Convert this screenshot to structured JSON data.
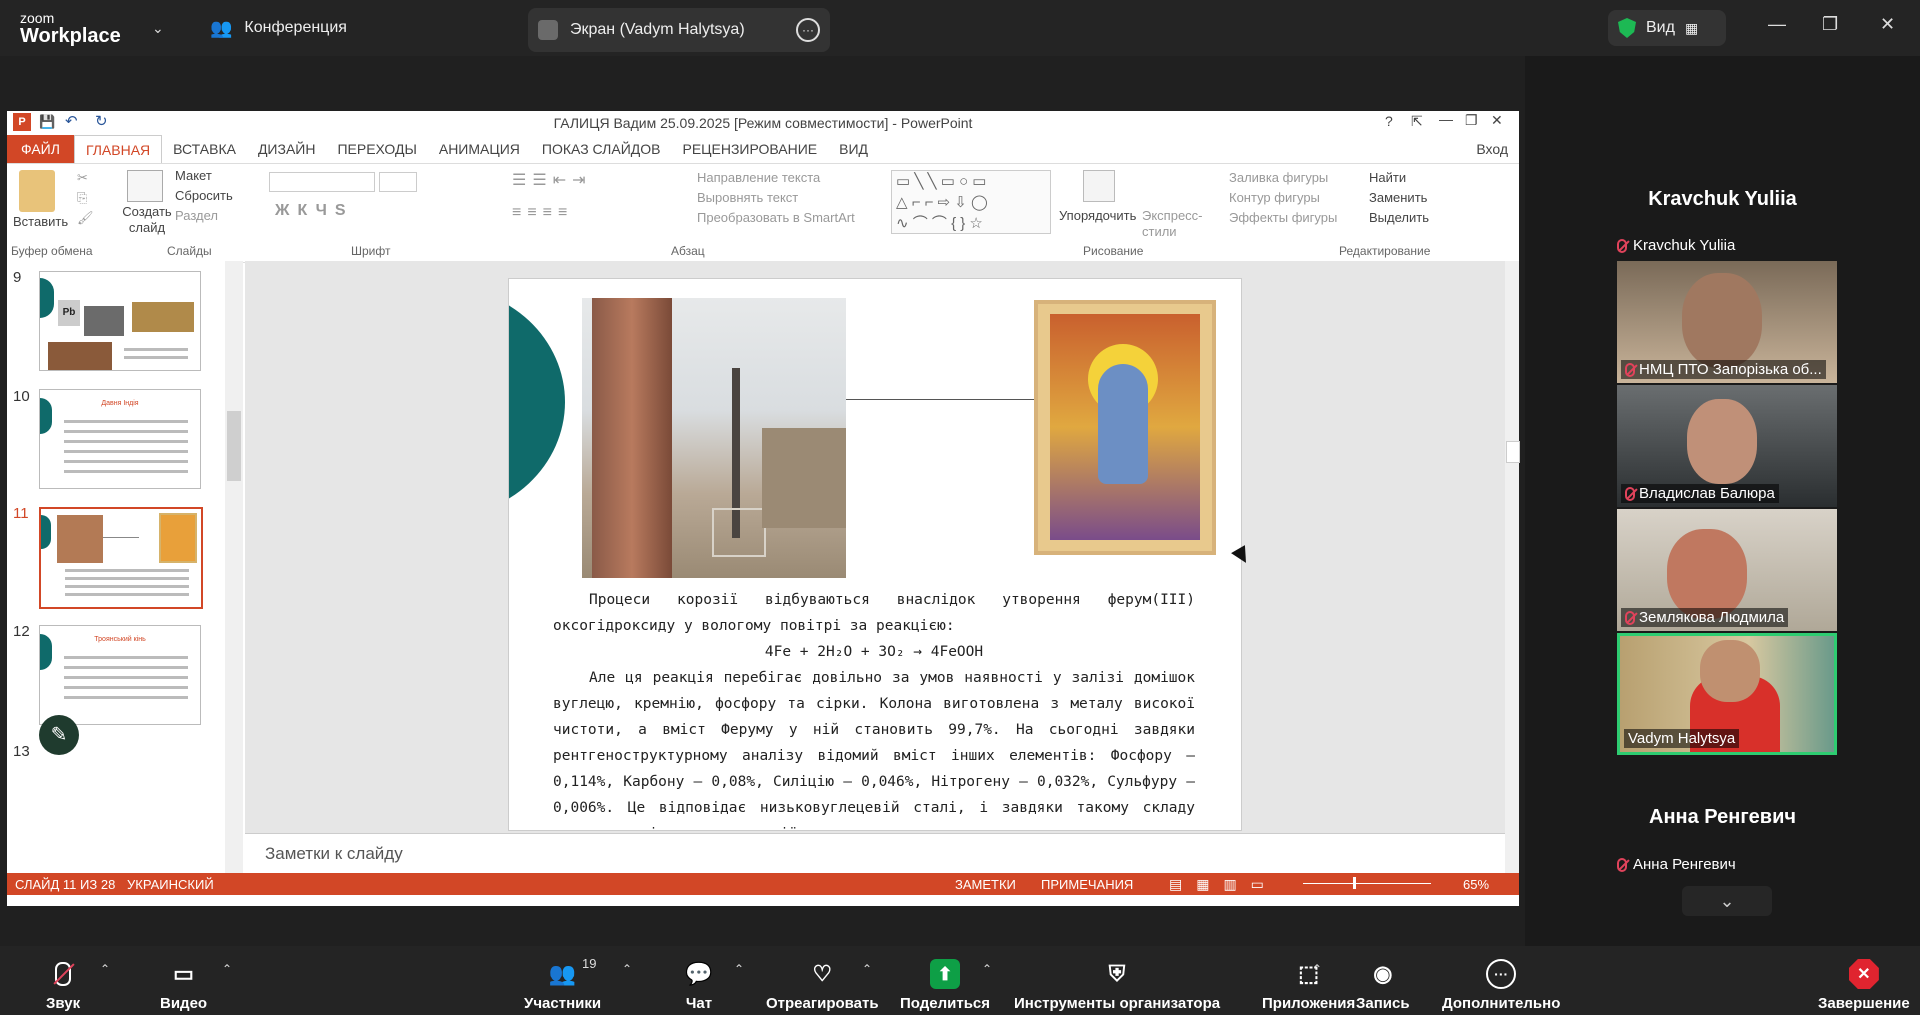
{
  "zoom": {
    "logo_small": "zoom",
    "logo_big": "Workplace",
    "conference_tab": "Конференция",
    "screen_tab": "Экран (Vadym Halytsya)",
    "view_label": "Вид"
  },
  "ppt": {
    "title": "ГАЛИЦЯ Вадим 25.09.2025 [Режим совместимости] - PowerPoint",
    "menu": [
      "ФАЙЛ",
      "ГЛАВНАЯ",
      "ВСТАВКА",
      "ДИЗАЙН",
      "ПЕРЕХОДЫ",
      "АНИМАЦИЯ",
      "ПОКАЗ СЛАЙДОВ",
      "РЕЦЕНЗИРОВАНИЕ",
      "ВИД"
    ],
    "login": "Вход",
    "ribbon": {
      "paste": "Вставить",
      "create_slide": "Создать слайд",
      "layout": "Макет",
      "reset": "Сбросить",
      "section": "Раздел",
      "text_direction": "Направление текста",
      "align_text": "Выровнять текст",
      "smartart": "Преобразовать в SmartArt",
      "arrange": "Упорядочить",
      "quick_styles": "Экспресс-стили",
      "shape_fill": "Заливка фигуры",
      "shape_outline": "Контур фигуры",
      "shape_effects": "Эффекты фигуры",
      "find": "Найти",
      "replace": "Заменить",
      "select": "Выделить",
      "groups": {
        "clipboard": "Буфер обмена",
        "slides": "Слайды",
        "font": "Шрифт",
        "paragraph": "Абзац",
        "drawing": "Рисование",
        "editing": "Редактирование"
      }
    },
    "thumbs": [
      {
        "num": "9",
        "title": ""
      },
      {
        "num": "10",
        "title": "Давня Індія"
      },
      {
        "num": "11",
        "title": ""
      },
      {
        "num": "12",
        "title": "Троянський кінь"
      },
      {
        "num": "13",
        "title": ""
      }
    ],
    "slide": {
      "para1": "Процеси корозії відбуваються внаслідок утворення ферум(ІІІ) оксогідроксиду у вологому повітрі за реакцією:",
      "equation": "4Fe + 2H₂O + 3O₂ → 4FeOOH",
      "para2": "Але ця реакція перебігає довільно за умов наявності у залізі домішок вуглецю, кремнію, фосфору та сірки. Колона виготовлена з металу високої чистоти, а вміст Феруму у ній становить 99,7%. На сьогодні завдяки рентгеноструктурному аналізу відомий вміст інших елементів: Фосфору – 0,114%, Карбону – 0,08%, Силіцію – 0,046%, Нітрогену – 0,032%, Сульфуру – 0,006%. Це відповідає низьковуглецевій сталі, і завдяки такому складу колона не піддається корозії."
    },
    "notes_placeholder": "Заметки к слайду",
    "status": {
      "slide_info": "СЛАЙД 11 ИЗ 28",
      "language": "УКРАИНСКИЙ",
      "notes": "ЗАМЕТКИ",
      "comments": "ПРИМЕЧАНИЯ",
      "zoom": "65%"
    }
  },
  "gallery": {
    "speaker_top": "Kravchuk Yuliia",
    "speaker_top_sub": "Kravchuk Yuliia",
    "tiles": [
      {
        "name": "НМЦ ПТО Запорізька об..."
      },
      {
        "name": "Владислав Балюра"
      },
      {
        "name": "Землякова Людмила"
      },
      {
        "name": "Vadym Halytsya"
      }
    ],
    "speaker_bottom": "Анна Ренгевич",
    "speaker_bottom_sub": "Анна Ренгевич"
  },
  "toolbar": {
    "audio": "Звук",
    "video": "Видео",
    "participants": "Участники",
    "participants_count": "19",
    "chat": "Чат",
    "react": "Отреагировать",
    "share": "Поделиться",
    "host_tools": "Инструменты организатора",
    "apps": "Приложения",
    "record": "Запись",
    "more": "Дополнительно",
    "end": "Завершение"
  },
  "colors": {
    "ppt_accent": "#d24726",
    "zoom_green": "#0e9f46",
    "teal": "#0f6a6a"
  }
}
